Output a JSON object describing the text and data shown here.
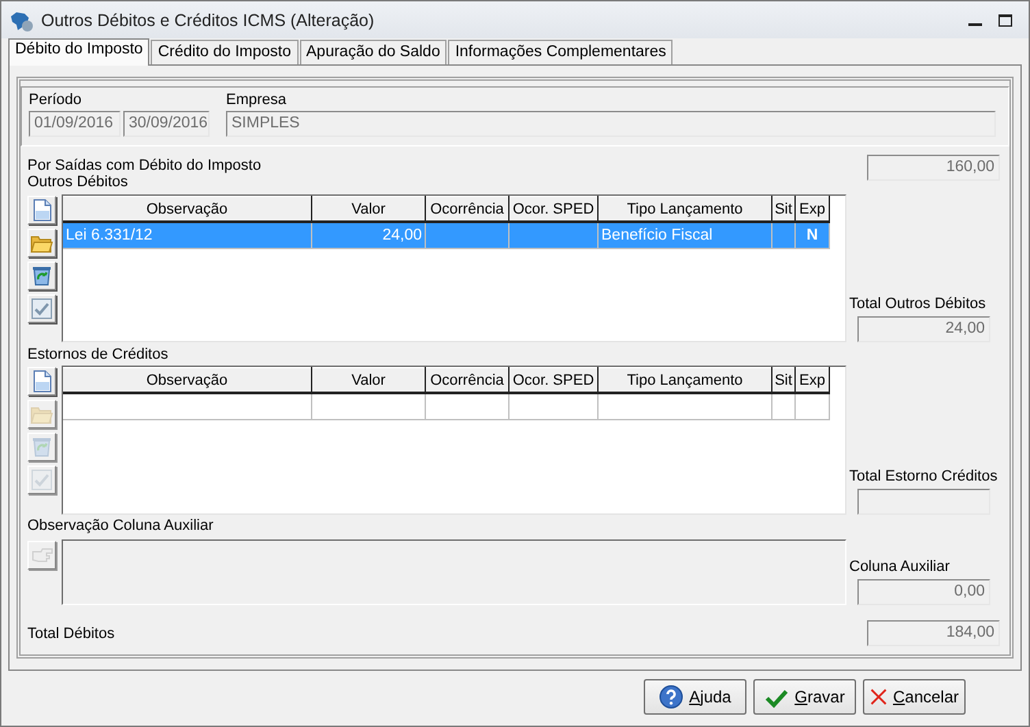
{
  "window": {
    "title": "Outros Débitos e Créditos ICMS (Alteração)"
  },
  "tabs": [
    {
      "label": "Débito do Imposto",
      "selected": true
    },
    {
      "label": "Crédito do Imposto",
      "selected": false
    },
    {
      "label": "Apuração do Saldo",
      "selected": false
    },
    {
      "label": "Informações Complementares",
      "selected": false
    }
  ],
  "period": {
    "label": "Período",
    "start": "01/09/2016",
    "end": "30/09/2016"
  },
  "company": {
    "label": "Empresa",
    "value": "SIMPLES"
  },
  "summary": {
    "label": "Por Saídas com Débito do Imposto",
    "value": "160,00"
  },
  "sections": [
    {
      "title": "Outros Débitos",
      "tools": [
        {
          "kind": "new",
          "disabled": false
        },
        {
          "kind": "open",
          "disabled": false
        },
        {
          "kind": "delete",
          "disabled": false
        },
        {
          "kind": "confirm",
          "disabled": false
        }
      ],
      "columns": [
        {
          "label": "Observação",
          "kind": "text"
        },
        {
          "label": "Valor",
          "kind": "number"
        },
        {
          "label": "Ocorrência",
          "kind": "text"
        },
        {
          "label": "Ocor. SPED",
          "kind": "text"
        },
        {
          "label": "Tipo Lançamento",
          "kind": "text"
        },
        {
          "label": "Sit",
          "kind": "text"
        },
        {
          "label": "Exp",
          "kind": "flag"
        }
      ],
      "rows": [
        {
          "selected": true,
          "cells": [
            "Lei 6.331/12",
            "24,00",
            null,
            null,
            "Benefício Fiscal",
            null,
            "N"
          ]
        }
      ],
      "total": {
        "label": "Total Outros Débitos",
        "value": "24,00"
      }
    },
    {
      "title": "Estornos de Créditos",
      "tools": [
        {
          "kind": "new",
          "disabled": false
        },
        {
          "kind": "open",
          "disabled": true
        },
        {
          "kind": "delete",
          "disabled": true
        },
        {
          "kind": "confirm",
          "disabled": true
        }
      ],
      "columns": [
        {
          "label": "Observação",
          "kind": "text"
        },
        {
          "label": "Valor",
          "kind": "number"
        },
        {
          "label": "Ocorrência",
          "kind": "text"
        },
        {
          "label": "Ocor. SPED",
          "kind": "text"
        },
        {
          "label": "Tipo Lançamento",
          "kind": "text"
        },
        {
          "label": "Sit",
          "kind": "text"
        },
        {
          "label": "Exp",
          "kind": "flag"
        }
      ],
      "rows": [
        {
          "selected": false,
          "cells": [
            null,
            null,
            null,
            null,
            null,
            null,
            null
          ]
        }
      ],
      "total": {
        "label": "Total Estorno Créditos"
      }
    }
  ],
  "aux": {
    "label": "Observação Coluna Auxiliar",
    "tool": {
      "kind": "hand",
      "disabled": true
    },
    "field_label": "Coluna Auxiliar",
    "value": "0,00"
  },
  "total_debits": {
    "label": "Total Débitos",
    "value": "184,00"
  },
  "buttons": [
    {
      "kind": "help",
      "label": "Ajuda"
    },
    {
      "kind": "save",
      "label": "Gravar"
    },
    {
      "kind": "cancel",
      "label": "Cancelar"
    }
  ]
}
